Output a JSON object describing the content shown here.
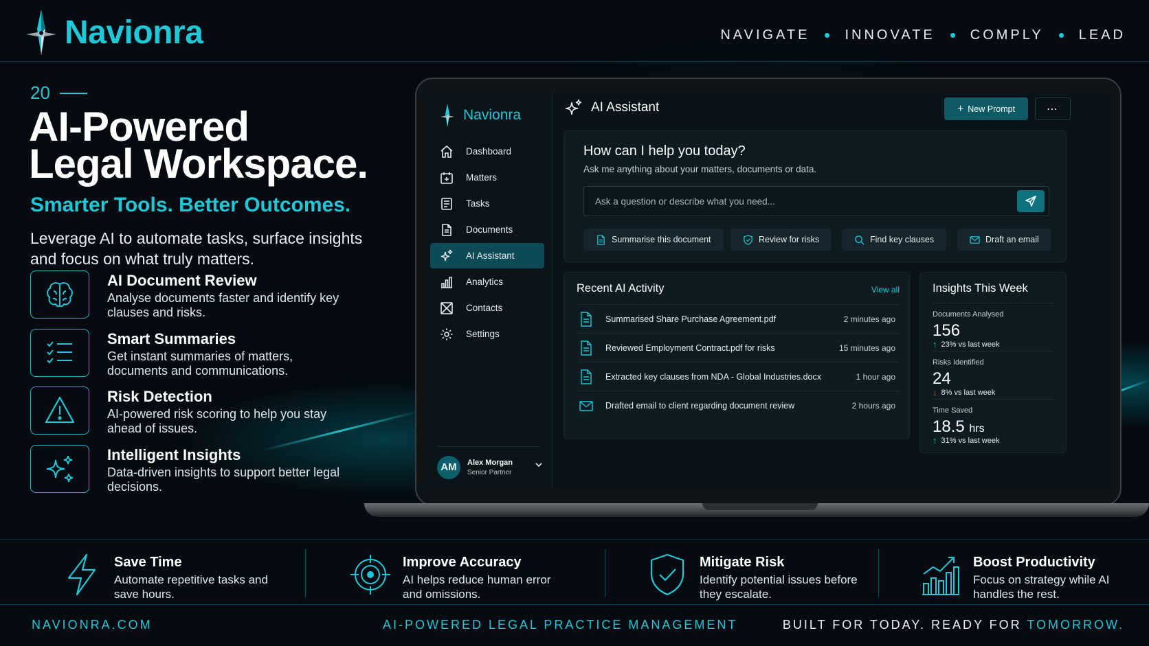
{
  "brand": {
    "name": "Navionra"
  },
  "tagline": [
    "NAVIGATE",
    "INNOVATE",
    "COMPLY",
    "LEAD"
  ],
  "hero": {
    "year": "20",
    "title_line1": "AI-Powered",
    "title_line2": "Legal Workspace.",
    "subtitle": "Smarter Tools. Better Outcomes.",
    "description": "Leverage AI to automate tasks, surface insights and focus on what truly matters."
  },
  "features": [
    {
      "icon": "brain-icon",
      "title": "AI Document Review",
      "desc": "Analyse documents faster and identify key clauses and risks."
    },
    {
      "icon": "checklist-icon",
      "title": "Smart Summaries",
      "desc": "Get instant summaries of matters, documents and communications."
    },
    {
      "icon": "warning-icon",
      "title": "Risk Detection",
      "desc": "AI-powered risk scoring to help you stay ahead of issues."
    },
    {
      "icon": "sparkle-icon",
      "title": "Intelligent Insights",
      "desc": "Data-driven insights to support better legal decisions."
    }
  ],
  "app": {
    "brand": "Navionra",
    "nav": [
      {
        "label": "Dashboard",
        "icon": "home-icon"
      },
      {
        "label": "Matters",
        "icon": "briefcase-icon"
      },
      {
        "label": "Tasks",
        "icon": "tasks-icon"
      },
      {
        "label": "Documents",
        "icon": "document-icon"
      },
      {
        "label": "AI Assistant",
        "icon": "sparkle-icon",
        "active": true
      },
      {
        "label": "Analytics",
        "icon": "bar-chart-icon"
      },
      {
        "label": "Contacts",
        "icon": "contacts-icon"
      },
      {
        "label": "Settings",
        "icon": "gear-icon"
      }
    ],
    "user": {
      "initials": "AM",
      "name": "Alex Morgan",
      "role": "Senior Partner"
    },
    "page_title": "AI Assistant",
    "new_prompt": "New Prompt",
    "more": "⋯",
    "ask": {
      "title": "How can I help you today?",
      "subtitle": "Ask me anything about your matters, documents or data.",
      "placeholder": "Ask a question or describe what you need..."
    },
    "chips": [
      {
        "label": "Summarise this document",
        "icon": "document-icon"
      },
      {
        "label": "Review for risks",
        "icon": "shield-icon"
      },
      {
        "label": "Find key clauses",
        "icon": "search-icon"
      },
      {
        "label": "Draft an email",
        "icon": "mail-icon"
      }
    ],
    "activity": {
      "title": "Recent AI Activity",
      "view_all": "View all",
      "items": [
        {
          "text": "Summarised Share Purchase Agreement.pdf",
          "time": "2 minutes ago",
          "icon": "document-icon"
        },
        {
          "text": "Reviewed Employment Contract.pdf for risks",
          "time": "15 minutes ago",
          "icon": "document-icon"
        },
        {
          "text": "Extracted key clauses from NDA - Global Industries.docx",
          "time": "1 hour ago",
          "icon": "document-icon"
        },
        {
          "text": "Drafted email to client regarding document review",
          "time": "2 hours ago",
          "icon": "mail-icon"
        }
      ]
    },
    "insights": {
      "title": "Insights This Week",
      "items": [
        {
          "label": "Documents Analysed",
          "value": "156",
          "unit": "",
          "delta": "23% vs last week",
          "direction": "up"
        },
        {
          "label": "Risks Identified",
          "value": "24",
          "unit": "",
          "delta": "8% vs last week",
          "direction": "down"
        },
        {
          "label": "Time Saved",
          "value": "18.5",
          "unit": "hrs",
          "delta": "31% vs last week",
          "direction": "up"
        }
      ]
    }
  },
  "benefits": [
    {
      "icon": "lightning-icon",
      "title": "Save Time",
      "desc": "Automate repetitive tasks and save hours."
    },
    {
      "icon": "target-icon",
      "title": "Improve Accuracy",
      "desc": "AI helps reduce human error and omissions."
    },
    {
      "icon": "shield-check-icon",
      "title": "Mitigate Risk",
      "desc": "Identify potential issues before they escalate."
    },
    {
      "icon": "growth-chart-icon",
      "title": "Boost Productivity",
      "desc": "Focus on strategy while AI handles the rest."
    }
  ],
  "footer": {
    "website": "NAVIONRA.COM",
    "middle": "AI-POWERED LEGAL PRACTICE MANAGEMENT",
    "right_prefix": "BUILT FOR TODAY. READY FOR ",
    "right_accent": "TOMORROW."
  },
  "colors": {
    "accent": "#1ec8d8",
    "background": "#050b10",
    "active_nav": "#0d4a55",
    "up": "#22c7a0",
    "down": "#e0463c"
  }
}
